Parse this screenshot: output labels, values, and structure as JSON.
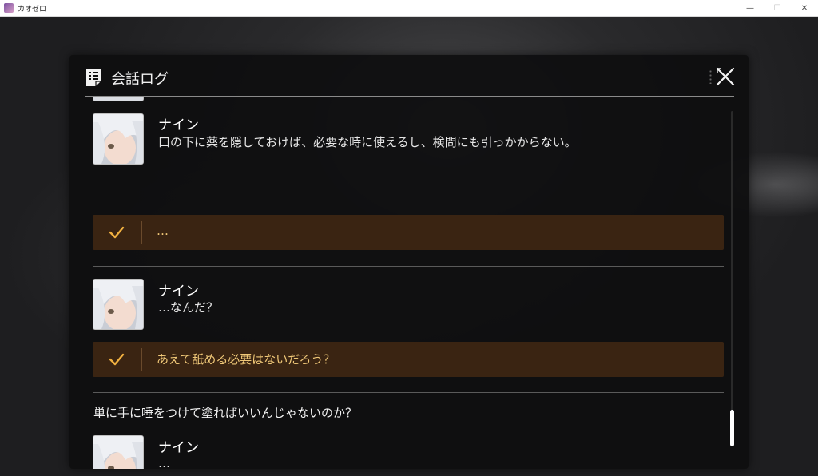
{
  "window": {
    "title": "カオゼロ",
    "minimize_glyph": "—",
    "maximize_glyph": "☐",
    "close_glyph": "✕"
  },
  "panel": {
    "title": "会話ログ",
    "icon": "log-icon",
    "close_icon": "close-icon"
  },
  "entries": [
    {
      "speaker": "ナイン",
      "text": "口の下に薬を隠しておけば、必要な時に使えるし、検問にも引っかからない。"
    },
    {
      "choice": "…"
    },
    {
      "speaker": "ナイン",
      "text": "…なんだ？"
    },
    {
      "choice": "あえて舐める必要はないだろう？"
    },
    {
      "narration": "単に手に唾をつけて塗ればいいんじゃないのか？"
    },
    {
      "speaker": "ナイン",
      "text": "…"
    }
  ],
  "colors": {
    "choice_bg": "#3a2412",
    "choice_text": "#f0c878",
    "check": "#f0b040"
  },
  "scrollbar": {
    "position": "bottom"
  }
}
